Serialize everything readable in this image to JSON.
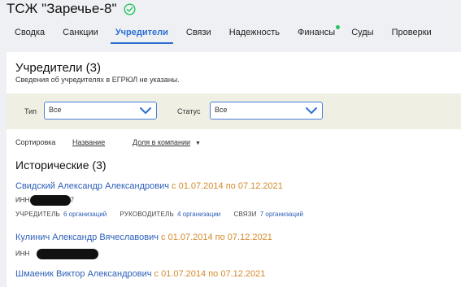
{
  "company": {
    "name": "ТСЖ \"Заречье-8\"",
    "status_icon": "check-circle-icon"
  },
  "tabs": [
    {
      "label": "Сводка"
    },
    {
      "label": "Санкции"
    },
    {
      "label": "Учредители"
    },
    {
      "label": "Связи"
    },
    {
      "label": "Надежность"
    },
    {
      "label": "Финансы"
    },
    {
      "label": "Суды"
    },
    {
      "label": "Проверки"
    }
  ],
  "active_tab": "Учредители",
  "main": {
    "title": "Учредители (3)",
    "subtitle": "Сведения об учредителях в ЕГРЮЛ не указаны."
  },
  "filters": {
    "type_label": "Тип",
    "type_value": "Все",
    "status_label": "Статус",
    "status_value": "Все"
  },
  "sort": {
    "label": "Сортировка",
    "by_name": "Название",
    "by_share": "Доля в компании"
  },
  "historical": {
    "title": "Исторические (3)",
    "persons": [
      {
        "name": "Свидский Александр Александрович",
        "period": "с 01.07.2014 по 07.12.2021",
        "inn_label": "ИНН",
        "inn_tail": "7",
        "founder_label": "УЧРЕДИТЕЛЬ",
        "founder_value": "6 организаций",
        "head_label": "РУКОВОДИТЕЛЬ",
        "head_value": "4 организации",
        "links_label": "СВЯЗИ",
        "links_value": "7 организаций"
      },
      {
        "name": "Кулинич Александр Вячеславович",
        "period": "с 01.07.2014 по 07.12.2021",
        "inn_label": "ИНН"
      },
      {
        "name": "Шмаеник Виктор Александрович",
        "period": "с 01.07.2014 по 07.12.2021"
      }
    ]
  },
  "colors": {
    "accent": "#2d6fd3",
    "period": "#d4892a",
    "filter_band": "#f0efe4",
    "status_dot": "#22c55e"
  }
}
